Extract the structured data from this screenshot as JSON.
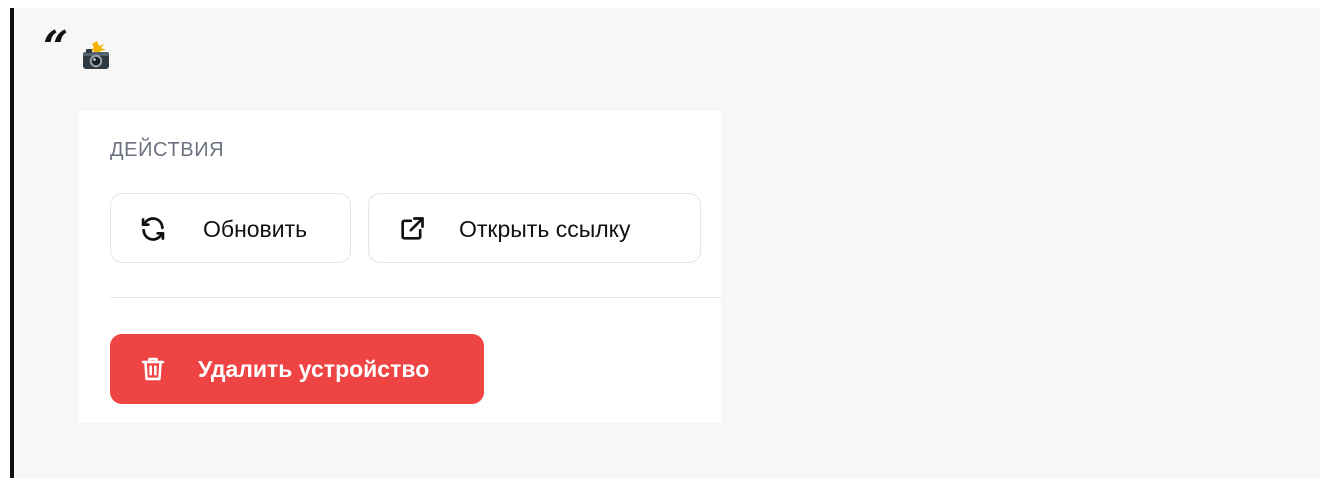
{
  "quote": {
    "mark": "“",
    "icon": "camera-with-flash-icon"
  },
  "actions": {
    "title": "ДЕЙСТВИЯ",
    "refresh_label": "Обновить",
    "refresh_icon": "refresh-icon",
    "open_link_label": "Открыть ссылку",
    "open_link_icon": "external-link-icon",
    "delete_label": "Удалить устройство",
    "delete_icon": "trash-icon"
  },
  "colors": {
    "danger": "#ef4444",
    "text": "#111111",
    "muted": "#6b7280",
    "quote_background": "#f7f7f7"
  }
}
